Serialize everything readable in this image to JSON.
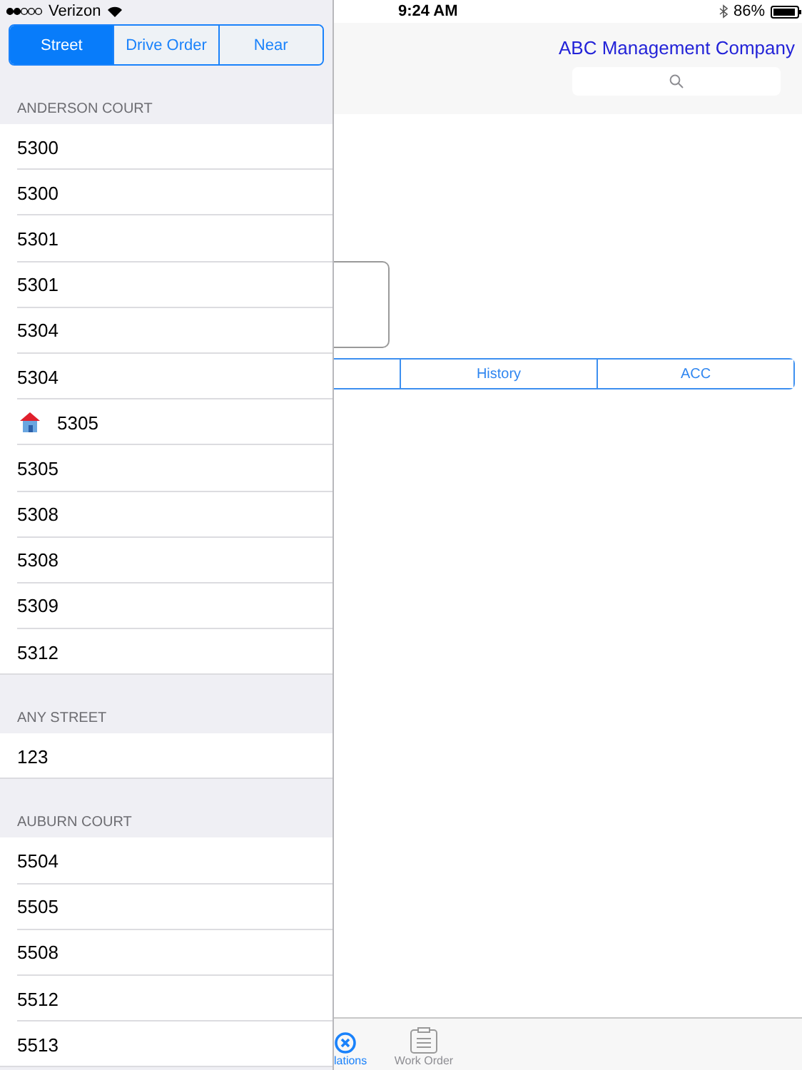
{
  "status_bar": {
    "carrier": "Verizon",
    "time": "9:24 AM",
    "battery": "86%"
  },
  "sort_tabs": [
    {
      "label": "Street",
      "selected": true
    },
    {
      "label": "Drive Order",
      "selected": false
    },
    {
      "label": "Near",
      "selected": false
    }
  ],
  "sections": [
    {
      "title": "ANDERSON COURT",
      "rows": [
        {
          "number": "5300",
          "kind": "plain"
        },
        {
          "number": "5300",
          "kind": "plain"
        },
        {
          "number": "5301",
          "kind": "plain"
        },
        {
          "number": "5301",
          "kind": "plain"
        },
        {
          "number": "5304",
          "kind": "plain"
        },
        {
          "number": "5304",
          "kind": "plain"
        },
        {
          "number": "5305",
          "kind": "house"
        },
        {
          "number": "5305",
          "kind": "plain"
        },
        {
          "number": "5308",
          "kind": "plain"
        },
        {
          "number": "5308",
          "kind": "plain"
        },
        {
          "number": "5309",
          "kind": "plain"
        },
        {
          "number": "5312",
          "kind": "plain"
        }
      ]
    },
    {
      "title": "ANY STREET",
      "rows": [
        {
          "number": "123",
          "kind": "plain"
        }
      ]
    },
    {
      "title": "AUBURN COURT",
      "rows": [
        {
          "number": "5504",
          "kind": "plain"
        },
        {
          "number": "5505",
          "kind": "plain"
        },
        {
          "number": "5508",
          "kind": "plain"
        },
        {
          "number": "5512",
          "kind": "plain"
        },
        {
          "number": "5513",
          "kind": "plain"
        }
      ]
    }
  ],
  "nav": {
    "title": "ABC Management Company"
  },
  "detail_tabs": [
    {
      "label": "History"
    },
    {
      "label": "ACC"
    }
  ],
  "tab_bar": [
    {
      "label": "lations",
      "kind": "close",
      "selected": true
    },
    {
      "label": "Work Order",
      "kind": "clipboard",
      "selected": false
    }
  ]
}
